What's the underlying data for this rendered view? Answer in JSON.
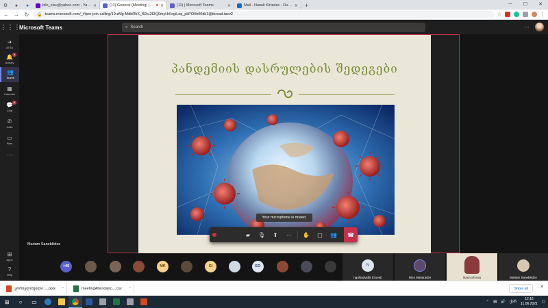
{
  "browser": {
    "tabs": [
      {
        "title": "",
        "active": false,
        "icon": "gear-icon"
      },
      {
        "title": "",
        "active": false,
        "icon": "github-icon"
      },
      {
        "title": "",
        "active": false,
        "icon": "facebook-icon"
      },
      {
        "title": "bilo_elsu@yahoo.com - Yahoo M",
        "active": false,
        "icon": "yahoo-icon",
        "color": "#6001d2"
      },
      {
        "title": "(11) General (Meeting) | Mic",
        "active": true,
        "icon": "teams-icon",
        "color": "#5b5fc7"
      },
      {
        "title": "(11) | Microsoft Teams",
        "active": false,
        "icon": "teams-icon",
        "color": "#5b5fc7"
      },
      {
        "title": "Mail - Nanuli Kirtadze - Outlook",
        "active": false,
        "icon": "outlook-icon",
        "color": "#0f6cbd"
      }
    ],
    "url": "teams.microsoft.com/_#/pre-join-calling/19:zMg-MdbRhX_f9Xu2EIQ0myHr0sgiLoq_pkPO0h00dk1@thread.tacv2",
    "new_tab": "+",
    "window_min": "─",
    "window_max": "☐",
    "window_close": "✕"
  },
  "teams": {
    "title": "Microsoft Teams",
    "search_placeholder": "Search",
    "rail": [
      {
        "label": "ATSU",
        "icon": "arrow-icon",
        "badge": ""
      },
      {
        "label": "Activity",
        "icon": "bell-icon",
        "badge": "9"
      },
      {
        "label": "Teams",
        "icon": "teams-group-icon",
        "badge": "",
        "active": true
      },
      {
        "label": "Calendar",
        "icon": "calendar-icon",
        "badge": ""
      },
      {
        "label": "Chat",
        "icon": "chat-icon",
        "badge": "4"
      },
      {
        "label": "Calls",
        "icon": "phone-icon",
        "badge": ""
      },
      {
        "label": "Files",
        "icon": "file-icon",
        "badge": ""
      },
      {
        "label": "",
        "icon": "more-icon",
        "badge": ""
      }
    ],
    "rail_bottom": [
      {
        "label": "Apps",
        "icon": "apps-icon"
      },
      {
        "label": "Help",
        "icon": "help-icon"
      }
    ]
  },
  "meeting": {
    "slide_title": "პანდემიის დასრულების შედეგები",
    "presenter_name": "Mariam Sanebliidze",
    "toast": "Your microphone is muted.",
    "controls": [
      "camera-off-icon",
      "mic-off-icon",
      "share-icon",
      "more-icon",
      "raise-hand-icon",
      "chat-icon",
      "participants-icon"
    ],
    "overflow_count": "+45",
    "participants_round": [
      {
        "initials": "",
        "color": "#6b5a4a",
        "photo": true
      },
      {
        "initials": "",
        "color": "#7a6655",
        "photo": true
      },
      {
        "initials": "",
        "color": "#8a4a3a",
        "photo": true
      },
      {
        "initials": "MK",
        "color": "#f7d08a",
        "photo": false
      },
      {
        "initials": "",
        "color": "#5b4a3a",
        "photo": true
      },
      {
        "initials": "GI",
        "color": "#f2d48c",
        "photo": false
      },
      {
        "initials": "",
        "color": "#cfd9e6",
        "photo": true
      },
      {
        "initials": "EO",
        "color": "#dfe6f2",
        "photo": false
      },
      {
        "initials": "",
        "color": "#8c4a36",
        "photo": true
      },
      {
        "initials": "",
        "color": "#4a4a5a",
        "photo": true
      },
      {
        "initials": "",
        "color": "#3a3a3a",
        "photo": true
      }
    ],
    "participant_tiles": [
      {
        "name": "ngulbadvidi5 (Guest)",
        "initials": "N",
        "color": "#dfe6f2",
        "muted": true
      },
      {
        "name": "Nino Matiaradze",
        "initials": "",
        "color": "#5b4a6a",
        "muted": false
      },
      {
        "name": "Nana Shonia",
        "initials": "",
        "color": "#e8e0d0",
        "muted": true
      },
      {
        "name": "Mariam Sanebliidze",
        "initials": "",
        "color": "#d9c6b0",
        "muted": false
      }
    ]
  },
  "downloads": {
    "items": [
      {
        "name": "კორნელ(შვილი ....pptx",
        "color": "#d24726"
      },
      {
        "name": "meetingAttendanc....csv",
        "color": "#217346"
      }
    ],
    "show_all": "Show all",
    "close": "✕"
  },
  "taskbar": {
    "apps": [
      {
        "icon": "windows-start-icon",
        "color": "#ffffff"
      },
      {
        "icon": "search-icon",
        "color": "#ffffff"
      },
      {
        "icon": "task-view-icon",
        "color": "#ffffff"
      },
      {
        "icon": "edge-icon",
        "color": "#3277bc"
      },
      {
        "icon": "file-explorer-icon",
        "color": "#f2c94c"
      },
      {
        "icon": "chrome-icon",
        "color": "#db4437",
        "active": true
      },
      {
        "icon": "word-icon",
        "color": "#2b579a"
      },
      {
        "icon": "zoom-icon",
        "color": "#9aa0a6"
      },
      {
        "icon": "excel-icon",
        "color": "#217346"
      },
      {
        "icon": "photos-icon",
        "color": "#9aa0a6"
      },
      {
        "icon": "powerpoint-icon",
        "color": "#d24726"
      }
    ],
    "time": "12:16",
    "date": "11.06.2021",
    "lang": "ქარ"
  }
}
